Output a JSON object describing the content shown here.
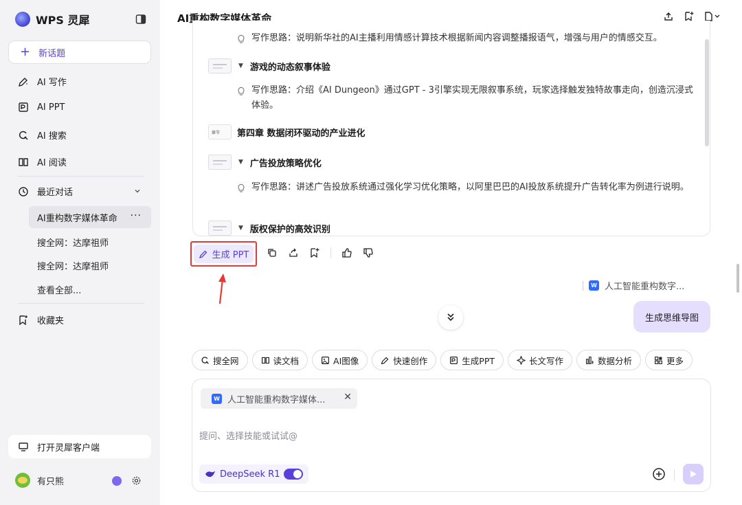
{
  "sidebar": {
    "app_name": "WPS 灵犀",
    "new_topic": "新话题",
    "nav": [
      {
        "label": "AI 写作",
        "icon": "pen-sparkle-icon"
      },
      {
        "label": "AI PPT",
        "icon": "ppt-icon"
      },
      {
        "label": "AI 搜索",
        "icon": "search-icon"
      },
      {
        "label": "AI 阅读",
        "icon": "book-icon"
      }
    ],
    "recent_label": "最近对话",
    "recent_items": [
      "AI重构数字媒体革命",
      "搜全网：达摩祖师",
      "搜全网：达摩祖师",
      "查看全部..."
    ],
    "favorites": "收藏夹",
    "client_button": "打开灵犀客户端",
    "user_name": "有只熊"
  },
  "header": {
    "title": "AI重构数字媒体革命"
  },
  "outline": {
    "items": [
      {
        "kind": "thought",
        "text": "写作思路：说明新华社的AI主播利用情感计算技术根据新闻内容调整播报语气，增强与用户的情感交互。"
      },
      {
        "kind": "section",
        "text": "游戏的动态叙事体验"
      },
      {
        "kind": "thought",
        "text": "写作思路：介绍《AI Dungeon》通过GPT - 3引擎实现无限叙事系统，玩家选择触发独特故事走向，创造沉浸式体验。"
      },
      {
        "kind": "chapter",
        "text": "第四章 数据闭环驱动的产业进化",
        "thumb": "章节"
      },
      {
        "kind": "section",
        "text": "广告投放策略优化"
      },
      {
        "kind": "thought",
        "text": "写作思路：讲述广告投放系统通过强化学习优化策略，以阿里巴巴的AI投放系统提升广告转化率为例进行说明。"
      },
      {
        "kind": "section",
        "text": "版权保护的高效识别"
      }
    ]
  },
  "actions": {
    "generate_ppt": "生成 PPT"
  },
  "reference": {
    "doc_name": "人工智能重构数字...",
    "word_badge": "W"
  },
  "mindmap_button": "生成思维导图",
  "skills": [
    {
      "label": "搜全网",
      "icon": "search-icon"
    },
    {
      "label": "读文档",
      "icon": "book-icon"
    },
    {
      "label": "AI图像",
      "icon": "image-icon"
    },
    {
      "label": "快速创作",
      "icon": "pen-sparkle-icon"
    },
    {
      "label": "生成PPT",
      "icon": "ppt-icon"
    },
    {
      "label": "长文写作",
      "icon": "sparkle-icon"
    },
    {
      "label": "数据分析",
      "icon": "chart-icon"
    },
    {
      "label": "更多",
      "icon": "grid-icon"
    }
  ],
  "composer": {
    "attachment": "人工智能重构数字媒体...",
    "attachment_badge": "W",
    "placeholder": "提问、选择技能或试试@",
    "model": "DeepSeek R1",
    "model_enabled": true
  },
  "colors": {
    "accent": "#5b3fd9",
    "highlight_border": "#e53935",
    "sidebar_bg": "#f3f3f5",
    "mindmap_bg": "#e6defd"
  }
}
